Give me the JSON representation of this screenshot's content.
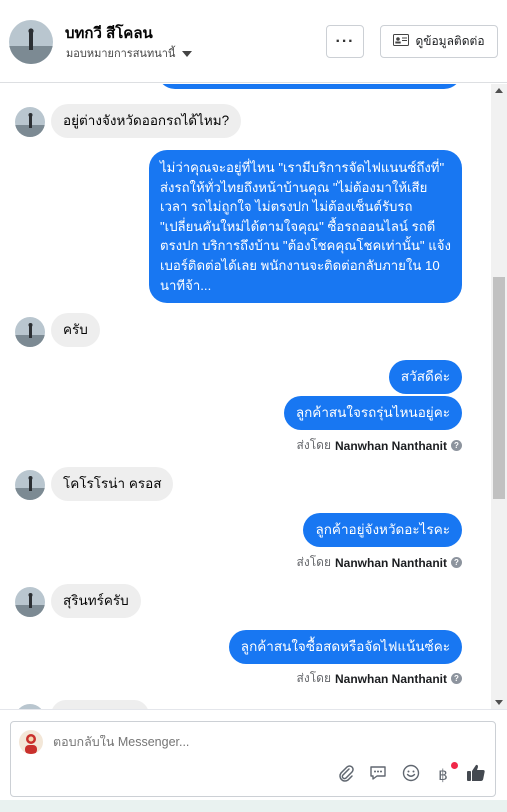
{
  "header": {
    "contact_name": "บทกวี สีโคลน",
    "assign_label": "มอบหมายการสนทนานี้",
    "more_label": "···",
    "view_info_label": "ดูข้อมูลติดต่อ"
  },
  "messages": [
    {
      "dir": "in",
      "text": "อยู่ต่างจังหวัดออกรถได้ไหม?"
    },
    {
      "dir": "out",
      "text": "ไม่ว่าคุณจะอยู่ที่ไหน \"เรามีบริการจัดไฟแนนซ์ถึงที่\"  ส่งรถให้ทั่วไทยถึงหน้าบ้านคุณ \"ไม่ต้องมาให้เสียเวลา รถไม่ถูกใจ ไม่ตรงปก ไม่ต้องเซ็นต์รับรถ \"เปลี่ยนคันใหม่ได้ตามใจคุณ\" ซื้อรถออนไลน์ รถดีตรงปก บริการถึงบ้าน \"ต้องโชคคุณโชคเท่านั้น\" แจ้งเบอร์ติดต่อได้เลย พนักงานจะติดต่อกลับภายใน 10 นาทีจ้า..."
    },
    {
      "dir": "in",
      "text": "ครับ"
    },
    {
      "dir": "out",
      "text": "สวัสดีค่ะ"
    },
    {
      "dir": "out",
      "text": "ลูกค้าสนใจรถรุ่นไหนอยู่คะ"
    },
    {
      "dir": "in",
      "text": "โคโรโรน่า ครอส"
    },
    {
      "dir": "out",
      "text": "ลูกค้าอยู่จังหวัดอะไรคะ"
    },
    {
      "dir": "in",
      "text": "สุรินทร์ครับ"
    },
    {
      "dir": "out",
      "text": "ลูกค้าสนใจซื้อสดหรือจัดไฟแน้นซ์คะ"
    }
  ],
  "sent_by": {
    "prefix": "ส่งโดย",
    "name": "Nanwhan Nanthanit",
    "help_glyph": "?"
  },
  "composer": {
    "placeholder": "ตอบกลับใน Messenger...",
    "currency_symbol": "฿"
  },
  "icons": {
    "attach": "paperclip-icon",
    "saved_replies": "speech-bubble-icon",
    "emoji": "smiley-icon",
    "payment": "baht-icon",
    "like": "thumbs-up-icon"
  },
  "colors": {
    "outgoing_bubble": "#1877f2",
    "incoming_bubble": "#eeeeee",
    "notification_dot": "#f02849"
  }
}
